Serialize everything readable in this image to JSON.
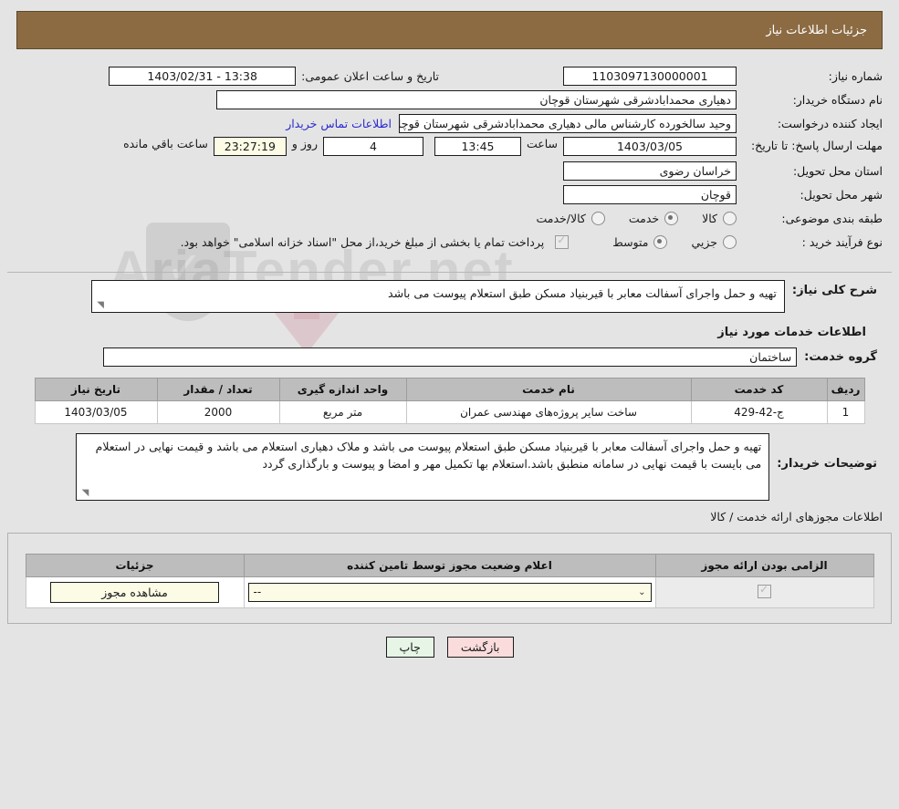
{
  "header": {
    "title": "جزئیات اطلاعات نیاز"
  },
  "info": {
    "need_number_label": "شماره نیاز:",
    "need_number_value": "1103097130000001",
    "announce_label": "تاریخ و ساعت اعلان عمومی:",
    "announce_value": "1403/02/31 - 13:38",
    "buyer_org_label": "نام دستگاه خریدار:",
    "buyer_org_value": "دهیاری محمدابادشرقی  شهرستان قوچان",
    "creator_label": "ایجاد کننده درخواست:",
    "creator_value": "وحید سالخورده کارشناس مالی دهیاری محمدابادشرقی  شهرستان قوچان",
    "contact_link": "اطلاعات تماس خریدار",
    "deadline_label": "مهلت ارسال پاسخ: تا تاریخ:",
    "deadline_date": "1403/03/05",
    "hour_label": "ساعت",
    "hour_value": "13:45",
    "days_value": "4",
    "days_label": "روز و",
    "countdown_value": "23:27:19",
    "remaining_label": "ساعت باقي مانده",
    "province_label": "استان محل تحویل:",
    "province_value": "خراسان رضوی",
    "city_label": "شهر محل تحویل:",
    "city_value": "قوچان",
    "category_label": "طبقه بندی موضوعی:",
    "category_options": [
      {
        "label": "کالا",
        "checked": false
      },
      {
        "label": "خدمت",
        "checked": true
      },
      {
        "label": "کالا/خدمت",
        "checked": false
      }
    ],
    "process_label": "نوع فرآیند خرید :",
    "process_options": [
      {
        "label": "جزیي",
        "checked": false
      },
      {
        "label": "متوسط",
        "checked": true
      }
    ],
    "treasury_note": "پرداخت تمام یا بخشی از مبلغ خرید،از محل \"اسناد خزانه اسلامی\" خواهد بود.",
    "treasury_checked": true
  },
  "general": {
    "label": "شرح کلی نیاز:",
    "value": "تهیه و حمل واجرای آسفالت معابر با قیربنیاد مسکن طبق استعلام پیوست می باشد"
  },
  "services": {
    "section_title": "اطلاعات خدمات مورد نیاز",
    "group_label": "گروه خدمت:",
    "group_value": "ساختمان",
    "columns": [
      "ردیف",
      "کد خدمت",
      "نام خدمت",
      "واحد اندازه گیری",
      "تعداد / مقدار",
      "تاریخ نیاز"
    ],
    "rows": [
      {
        "index": "1",
        "code": "ج-42-429",
        "name": "ساخت سایر پروژه‌های مهندسی عمران",
        "unit": "متر مربع",
        "quantity": "2000",
        "date": "1403/03/05"
      }
    ]
  },
  "buyer_notes": {
    "label": "توضیحات خریدار:",
    "value": "تهیه و حمل واجرای آسفالت معابر با قیربنیاد مسکن طبق استعلام پیوست می باشد و ملاک دهیاری استعلام می باشد و قیمت نهایی در استعلام می بایست با قیمت نهایی در سامانه منطبق باشد.استعلام بها تکمیل مهر و امضا و پیوست و بارگذاری گردد"
  },
  "permits": {
    "title": "اطلاعات مجوزهای ارائه خدمت / کالا",
    "columns": [
      "الزامی بودن ارائه مجوز",
      "اعلام وضعیت مجوز توسط تامین کننده",
      "جزئیات"
    ],
    "rows": [
      {
        "required": true,
        "status_value": "--",
        "details_button": "مشاهده مجوز"
      }
    ]
  },
  "footer": {
    "print_label": "چاپ",
    "back_label": "بازگشت"
  },
  "watermark": {
    "text": "AriaTender.net"
  },
  "colors": {
    "header_bg": "#8c6b43",
    "page_bg": "#e4e4e4",
    "link": "#2a2ad0",
    "table_header_bg": "#bdbdbd",
    "yellow_field": "#fbfbe6",
    "back_button": "#fbdcdc",
    "print_button": "#e6f5e6"
  }
}
